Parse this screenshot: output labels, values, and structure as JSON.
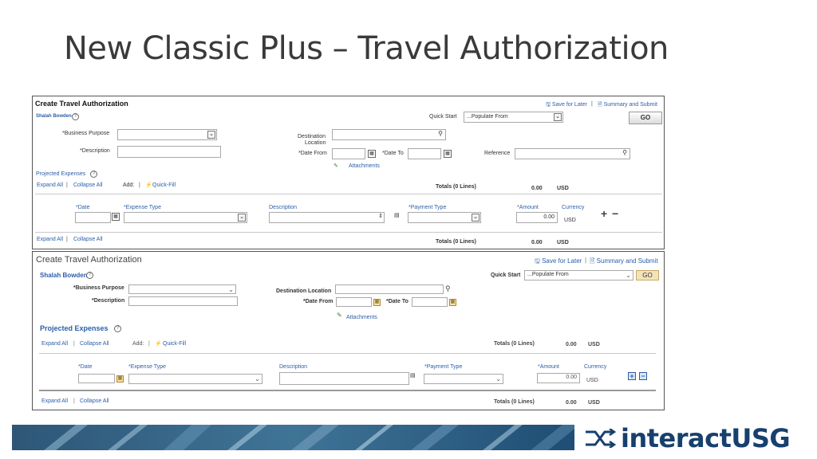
{
  "slide": {
    "title": "New Classic Plus – Travel Authorization"
  },
  "shot1": {
    "page_title": "Create Travel Authorization",
    "save_for_later": "Save for Later",
    "separator": "|",
    "summary_submit": "Summary and Submit",
    "user_name": "Shalah Bowden",
    "quick_start_label": "Quick Start",
    "quick_start_value": "...Populate From",
    "go": "GO",
    "business_purpose_label": "*Business Purpose",
    "description_label": "*Description",
    "destination_label_line1": "Destination",
    "destination_label_line2": "Location",
    "date_from_label": "*Date From",
    "date_to_label": "*Date To",
    "reference_label": "Reference",
    "attachments": "Attachments",
    "projected_expenses": "Projected Expenses",
    "expand_all": "Expand All",
    "collapse_all": "Collapse All",
    "add_label": "Add:",
    "quick_fill": "Quick-Fill",
    "totals_label": "Totals (0 Lines)",
    "totals_amount": "0.00",
    "totals_currency": "USD",
    "columns": {
      "date": "*Date",
      "expense_type": "*Expense Type",
      "description": "Description",
      "payment_type": "*Payment Type",
      "amount": "*Amount",
      "currency": "Currency"
    },
    "row_amount": "0.00",
    "row_currency": "USD",
    "plus": "+",
    "minus": "−"
  },
  "shot2": {
    "page_title": "Create Travel Authorization",
    "save_for_later": "Save for Later",
    "separator": "|",
    "summary_submit": "Summary and Submit",
    "user_name": "Shalah Bowden",
    "quick_start_label": "Quick Start",
    "quick_start_value": "...Populate From",
    "go": "GO",
    "business_purpose_label": "*Business Purpose",
    "description_label": "*Description",
    "destination_label": "Destination Location",
    "date_from_label": "*Date From",
    "date_to_label": "*Date To",
    "attachments": "Attachments",
    "projected_expenses": "Projected Expenses",
    "expand_all": "Expand All",
    "collapse_all": "Collapse All",
    "add_label": "Add:",
    "quick_fill": "Quick-Fill",
    "totals_label": "Totals (0 Lines)",
    "totals_amount": "0.00",
    "totals_currency": "USD",
    "columns": {
      "date": "*Date",
      "expense_type": "*Expense Type",
      "description": "Description",
      "payment_type": "*Payment Type",
      "amount": "*Amount",
      "currency": "Currency"
    },
    "row_amount": "0.00",
    "row_currency": "USD",
    "plus": "+",
    "minus": "−"
  },
  "footer": {
    "logo_text": "interactUSG"
  },
  "colors": {
    "link": "#2b5ea8",
    "logo": "#17406d",
    "band_dark": "#1f4d73",
    "band_light": "#7fa7c2"
  },
  "icons": [
    "help-icon",
    "search-icon",
    "calendar-icon",
    "attachment-icon",
    "quick-fill-icon",
    "save-icon",
    "summary-icon",
    "spellcheck-icon",
    "logo-mark-icon"
  ]
}
